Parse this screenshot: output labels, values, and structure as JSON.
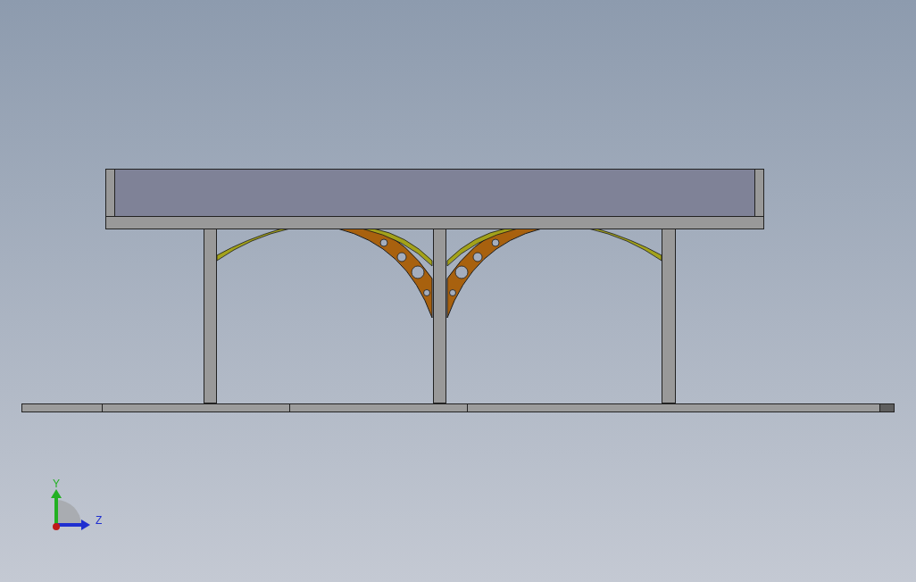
{
  "viewport": {
    "triad": {
      "axes": [
        {
          "label": "Y"
        },
        {
          "label": "Z"
        }
      ]
    }
  }
}
